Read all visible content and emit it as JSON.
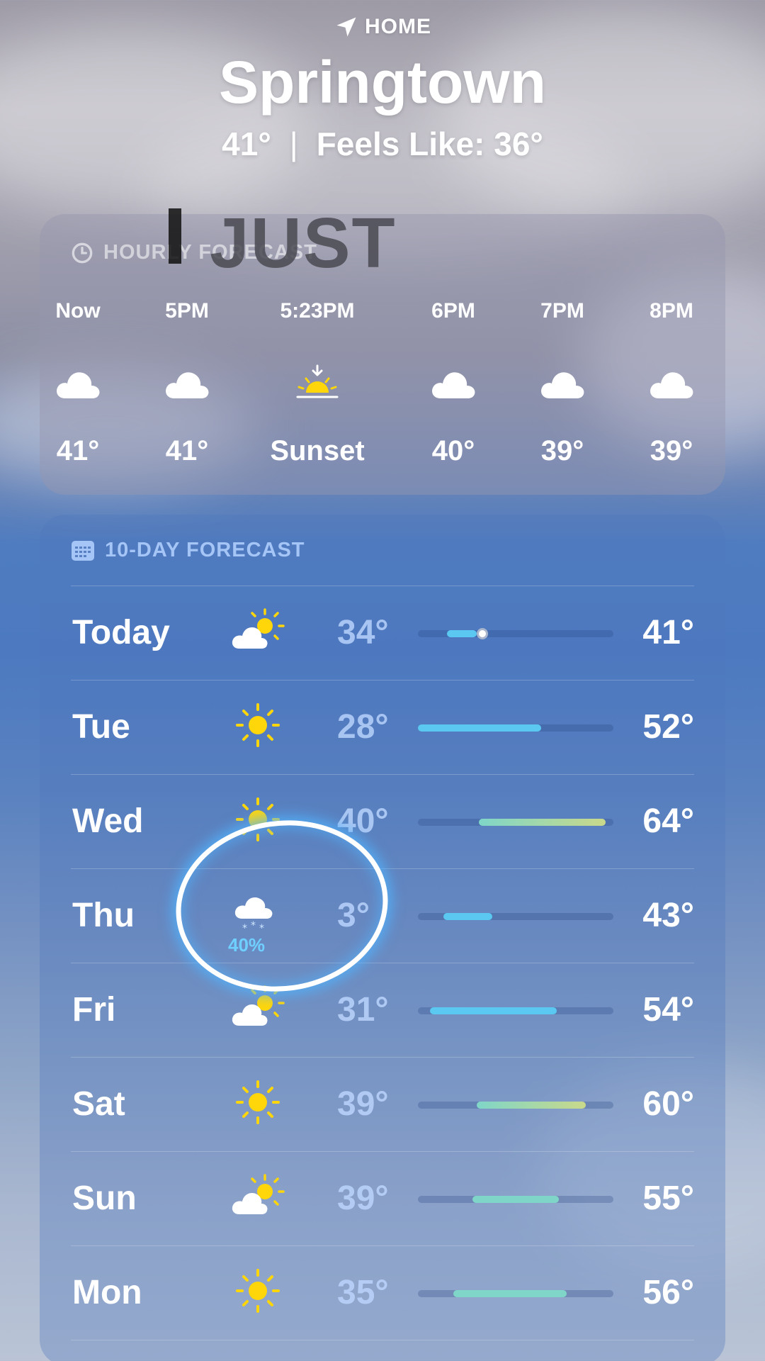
{
  "header": {
    "location_label": "HOME",
    "city": "Springtown",
    "current_temp": "41°",
    "separator": "|",
    "feels_like": "Feels Like: 36°"
  },
  "overlay_caption": "JUST",
  "hourly": {
    "title": "HOURLY FORECAST",
    "items": [
      {
        "time": "Now",
        "icon": "cloud-icon",
        "value": "41°"
      },
      {
        "time": "5PM",
        "icon": "cloud-icon",
        "value": "41°"
      },
      {
        "time": "5:23PM",
        "icon": "sunset-icon",
        "value": "Sunset"
      },
      {
        "time": "6PM",
        "icon": "cloud-icon",
        "value": "40°"
      },
      {
        "time": "7PM",
        "icon": "cloud-icon",
        "value": "39°"
      },
      {
        "time": "8PM",
        "icon": "cloud-icon",
        "value": "39°"
      }
    ]
  },
  "tenday": {
    "title": "10-DAY FORECAST",
    "days": [
      {
        "day": "Today",
        "icon": "partly-cloudy-icon",
        "low": "34°",
        "high": "41°"
      },
      {
        "day": "Tue",
        "icon": "sun-icon",
        "low": "28°",
        "high": "52°"
      },
      {
        "day": "Wed",
        "icon": "sun-icon",
        "low": "40°",
        "high": "64°"
      },
      {
        "day": "Thu",
        "icon": "snow-cloud-icon",
        "low": "3°",
        "high": "43°",
        "precip": "40%"
      },
      {
        "day": "Fri",
        "icon": "partly-cloudy-icon",
        "low": "31°",
        "high": "54°"
      },
      {
        "day": "Sat",
        "icon": "sun-icon",
        "low": "39°",
        "high": "60°"
      },
      {
        "day": "Sun",
        "icon": "partly-cloudy-icon",
        "low": "39°",
        "high": "55°"
      },
      {
        "day": "Mon",
        "icon": "sun-icon",
        "low": "35°",
        "high": "56°"
      }
    ]
  },
  "colors": {
    "bar_cool": "#5ac8f0",
    "bar_mild": "#7fd6c8",
    "bar_warm": "#c9d98a",
    "precip": "#6fd0ff"
  }
}
